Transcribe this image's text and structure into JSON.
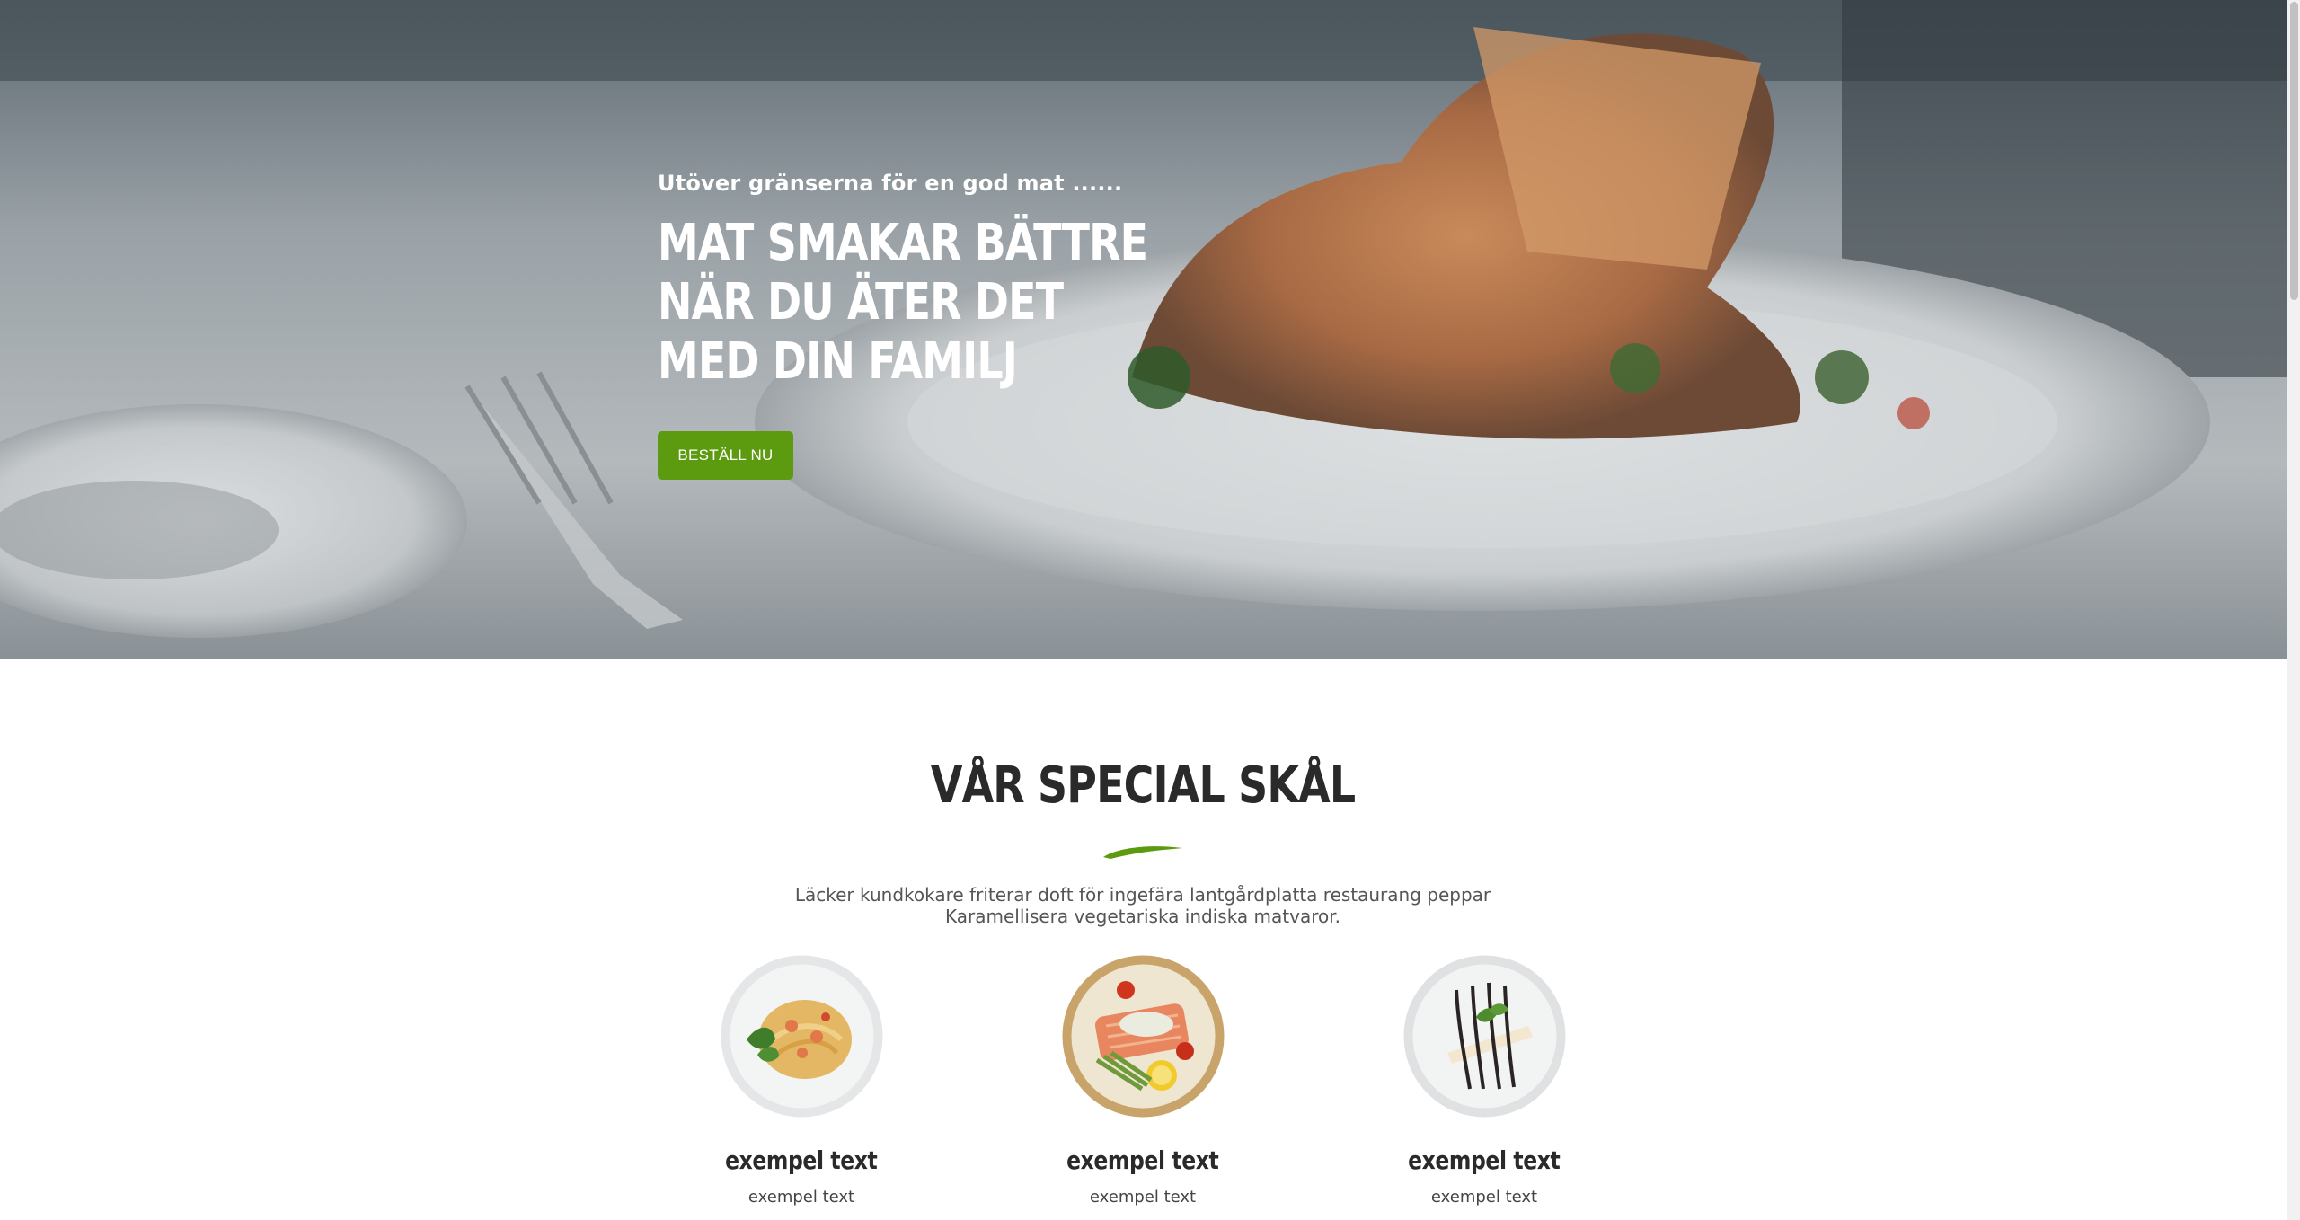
{
  "hero": {
    "tagline": "Utöver gränserna för en god mat ......",
    "title_lines": [
      "MAT SMAKAR BÄTTRE",
      "NÄR DU ÄTER DET",
      "MED DIN FAMILJ"
    ],
    "button_label": "BESTÄLL NU"
  },
  "special": {
    "title": "VÅR SPECIAL SKÅL",
    "description_lines": [
      "Läcker kundkokare friterar doft för ingefära lantgårdplatta restaurang peppar",
      "Karamellisera vegetariska indiska matvaror."
    ],
    "dishes": [
      {
        "title": "exempel text",
        "subtitle": "exempel text"
      },
      {
        "title": "exempel text",
        "subtitle": "exempel text"
      },
      {
        "title": "exempel text",
        "subtitle": "exempel text"
      }
    ]
  },
  "colors": {
    "accent": "#5c9a0f",
    "heading": "#2a2a2a",
    "body_text": "#555555"
  }
}
